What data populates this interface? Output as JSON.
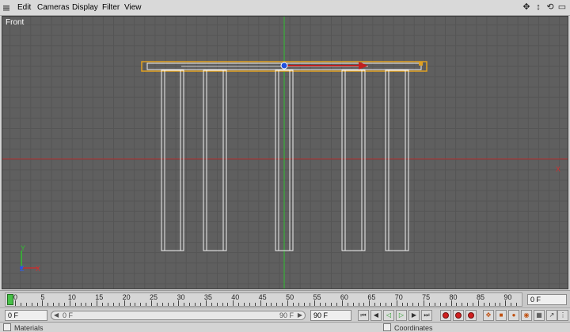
{
  "menu": {
    "items": [
      "Edit",
      "Cameras",
      "Display",
      "Filter",
      "View"
    ]
  },
  "nav_icons": [
    "move-view-icon",
    "dolly-view-icon",
    "rotate-view-icon",
    "maximize-view-icon"
  ],
  "viewport": {
    "label": "Front",
    "axis_labels": {
      "y": "Y",
      "z": "Z",
      "x": "X"
    },
    "colors": {
      "background": "#5f5f5f",
      "grid": "#555555",
      "wireframe": "#f0f0f0",
      "selection": "#e0a020",
      "y_axis": "#30c030",
      "x_axis": "#c03030"
    }
  },
  "timeline": {
    "ticks": [
      "0",
      "5",
      "10",
      "15",
      "20",
      "25",
      "30",
      "35",
      "40",
      "45",
      "50",
      "55",
      "60",
      "65",
      "70",
      "75",
      "80",
      "85",
      "90"
    ],
    "current_frame": "0 F"
  },
  "controls": {
    "start_frame": "0 F",
    "range_start": "0 F",
    "range_end": "90 F",
    "end_frame": "90 F"
  },
  "panels": {
    "materials": "Materials",
    "coordinates": "Coordinates"
  }
}
